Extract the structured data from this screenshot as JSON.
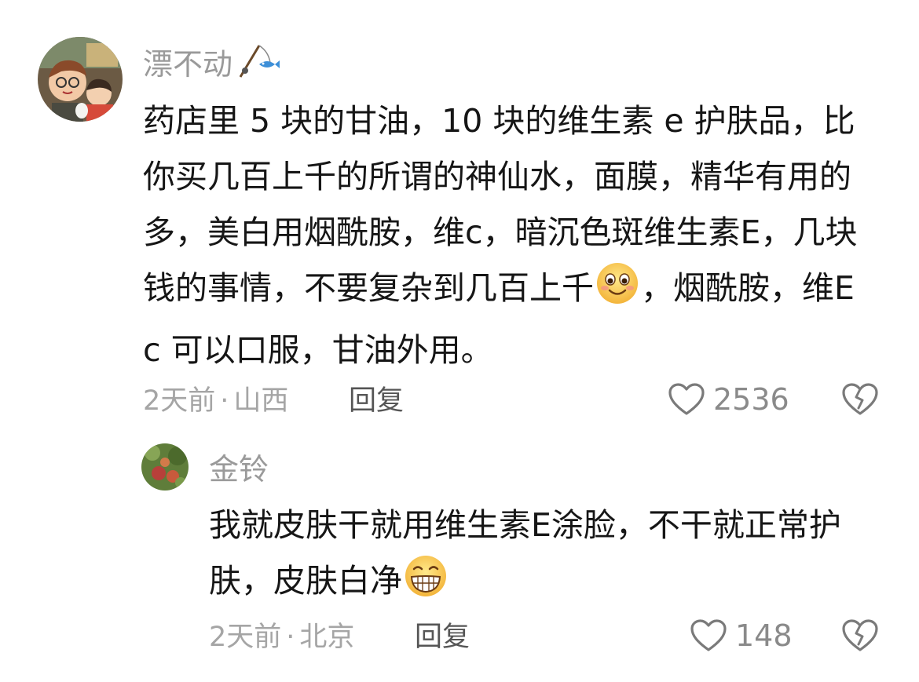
{
  "comment": {
    "username": "漂不动",
    "username_decoration": "fishing-rod-fish-icon",
    "text_parts": {
      "before_emoji": "药店里 5 块的甘油，10 块的维生素 e 护肤品，比你买几百上千的所谓的神仙水，面膜，精华有用的多，美白用烟酰胺，维c，暗沉色斑维生素E，几块钱的事情，不要复杂到几百上千",
      "emoji": "smile-emoji",
      "after_emoji": "，烟酰胺，维E c 可以口服，甘油外用。"
    },
    "time": "2天前",
    "location": "山西",
    "separator": "·",
    "reply_label": "回复",
    "likes": "2536"
  },
  "reply": {
    "username": "金铃",
    "text_parts": {
      "before_emoji": "我就皮肤干就用维生素E涂脸，不干就正常护肤，皮肤白净",
      "emoji": "grin-emoji"
    },
    "time": "2天前",
    "location": "北京",
    "separator": "·",
    "reply_label": "回复",
    "likes": "148"
  },
  "colors": {
    "username": "#9a9a9a",
    "text": "#161616",
    "meta": "#a5a5a5",
    "reply_button": "#555555",
    "icon_stroke": "#7a7a7a"
  }
}
